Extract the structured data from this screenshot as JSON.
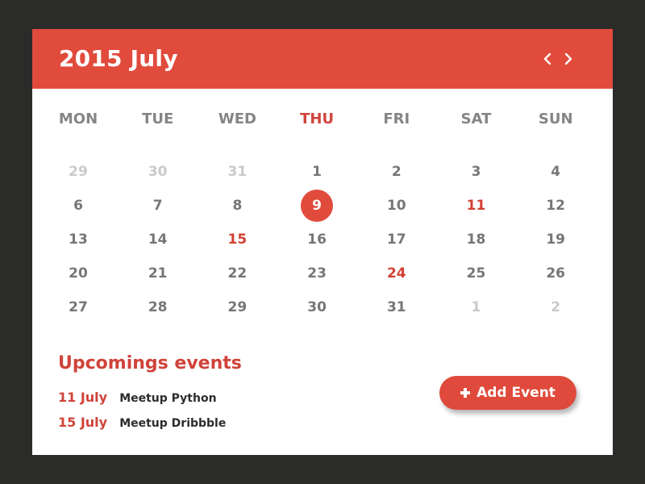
{
  "header": {
    "title": "2015 July",
    "prev_icon": "chevron-left-icon",
    "next_icon": "chevron-right-icon"
  },
  "weekdays": [
    {
      "label": "MON",
      "today": false
    },
    {
      "label": "TUE",
      "today": false
    },
    {
      "label": "WED",
      "today": false
    },
    {
      "label": "THU",
      "today": true
    },
    {
      "label": "FRI",
      "today": false
    },
    {
      "label": "SAT",
      "today": false
    },
    {
      "label": "SUN",
      "today": false
    }
  ],
  "weeks": [
    [
      {
        "d": "29",
        "state": "muted"
      },
      {
        "d": "30",
        "state": "muted"
      },
      {
        "d": "31",
        "state": "muted"
      },
      {
        "d": "1",
        "state": "normal"
      },
      {
        "d": "2",
        "state": "normal"
      },
      {
        "d": "3",
        "state": "normal"
      },
      {
        "d": "4",
        "state": "normal"
      }
    ],
    [
      {
        "d": "6",
        "state": "normal"
      },
      {
        "d": "7",
        "state": "normal"
      },
      {
        "d": "8",
        "state": "normal"
      },
      {
        "d": "9",
        "state": "selected"
      },
      {
        "d": "10",
        "state": "normal"
      },
      {
        "d": "11",
        "state": "event"
      },
      {
        "d": "12",
        "state": "normal"
      }
    ],
    [
      {
        "d": "13",
        "state": "normal"
      },
      {
        "d": "14",
        "state": "normal"
      },
      {
        "d": "15",
        "state": "event"
      },
      {
        "d": "16",
        "state": "normal"
      },
      {
        "d": "17",
        "state": "normal"
      },
      {
        "d": "18",
        "state": "normal"
      },
      {
        "d": "19",
        "state": "normal"
      }
    ],
    [
      {
        "d": "20",
        "state": "normal"
      },
      {
        "d": "21",
        "state": "normal"
      },
      {
        "d": "22",
        "state": "normal"
      },
      {
        "d": "23",
        "state": "normal"
      },
      {
        "d": "24",
        "state": "event"
      },
      {
        "d": "25",
        "state": "normal"
      },
      {
        "d": "26",
        "state": "normal"
      }
    ],
    [
      {
        "d": "27",
        "state": "normal"
      },
      {
        "d": "28",
        "state": "normal"
      },
      {
        "d": "29",
        "state": "normal"
      },
      {
        "d": "30",
        "state": "normal"
      },
      {
        "d": "31",
        "state": "normal"
      },
      {
        "d": "1",
        "state": "muted"
      },
      {
        "d": "2",
        "state": "muted"
      }
    ]
  ],
  "events": {
    "title": "Upcomings events",
    "items": [
      {
        "date": "11 July",
        "name": "Meetup Python"
      },
      {
        "date": "15 July",
        "name": "Meetup Dribbble"
      }
    ],
    "add_button_label": "Add Event",
    "add_button_icon": "plus-icon"
  },
  "colors": {
    "accent": "#e14b3c",
    "background": "#2b2b2a",
    "card": "#ffffff",
    "text_muted": "#c9c9c9",
    "text_normal": "#767676"
  }
}
